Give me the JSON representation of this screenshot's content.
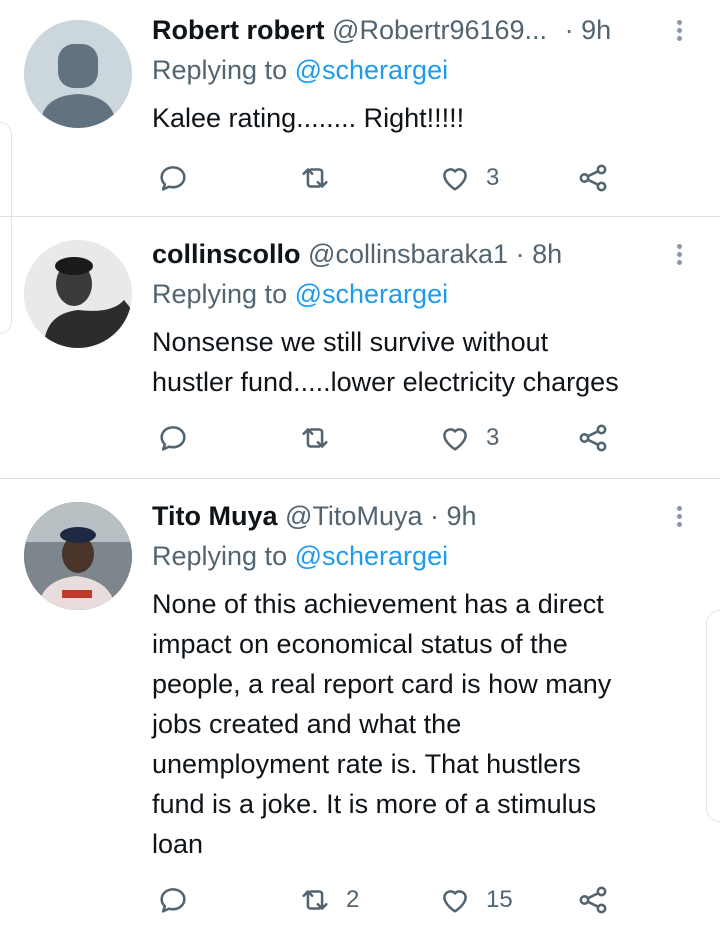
{
  "tweets": [
    {
      "name": "Robert robert",
      "handle": "@Robertr96169...",
      "separator": "·",
      "time": "9h",
      "replying_label": "Replying to",
      "replying_to": "@scherargei",
      "text_lines": [
        "Kalee rating........ Right!!!!!"
      ],
      "reply_count": "",
      "retweet_count": "",
      "like_count": "3"
    },
    {
      "name": "collinscollo",
      "handle": "@collinsbaraka1",
      "separator": "·",
      "time": "8h",
      "replying_label": "Replying to",
      "replying_to": "@scherargei",
      "text_lines": [
        "Nonsense we still survive without",
        "hustler fund.....lower electricity charges"
      ],
      "reply_count": "",
      "retweet_count": "",
      "like_count": "3"
    },
    {
      "name": "Tito Muya",
      "handle": "@TitoMuya",
      "separator": "·",
      "time": "9h",
      "replying_label": "Replying to",
      "replying_to": "@scherargei",
      "text_lines": [
        "None of this achievement has a direct",
        "impact on economical status of the",
        "people, a real report card is how many",
        "jobs created and what the",
        "unemployment rate is. That hustlers",
        "fund is a joke. It is more of a stimulus",
        "loan"
      ],
      "reply_count": "",
      "retweet_count": "2",
      "like_count": "15"
    }
  ],
  "icons": {
    "reply": "reply-icon",
    "retweet": "retweet-icon",
    "like": "heart-icon",
    "share": "share-icon",
    "more": "more-vertical-icon"
  },
  "colors": {
    "link": "#1d9bf0",
    "secondary_text": "#536471",
    "primary_text": "#0f1419",
    "divider": "#dcdfe3"
  }
}
